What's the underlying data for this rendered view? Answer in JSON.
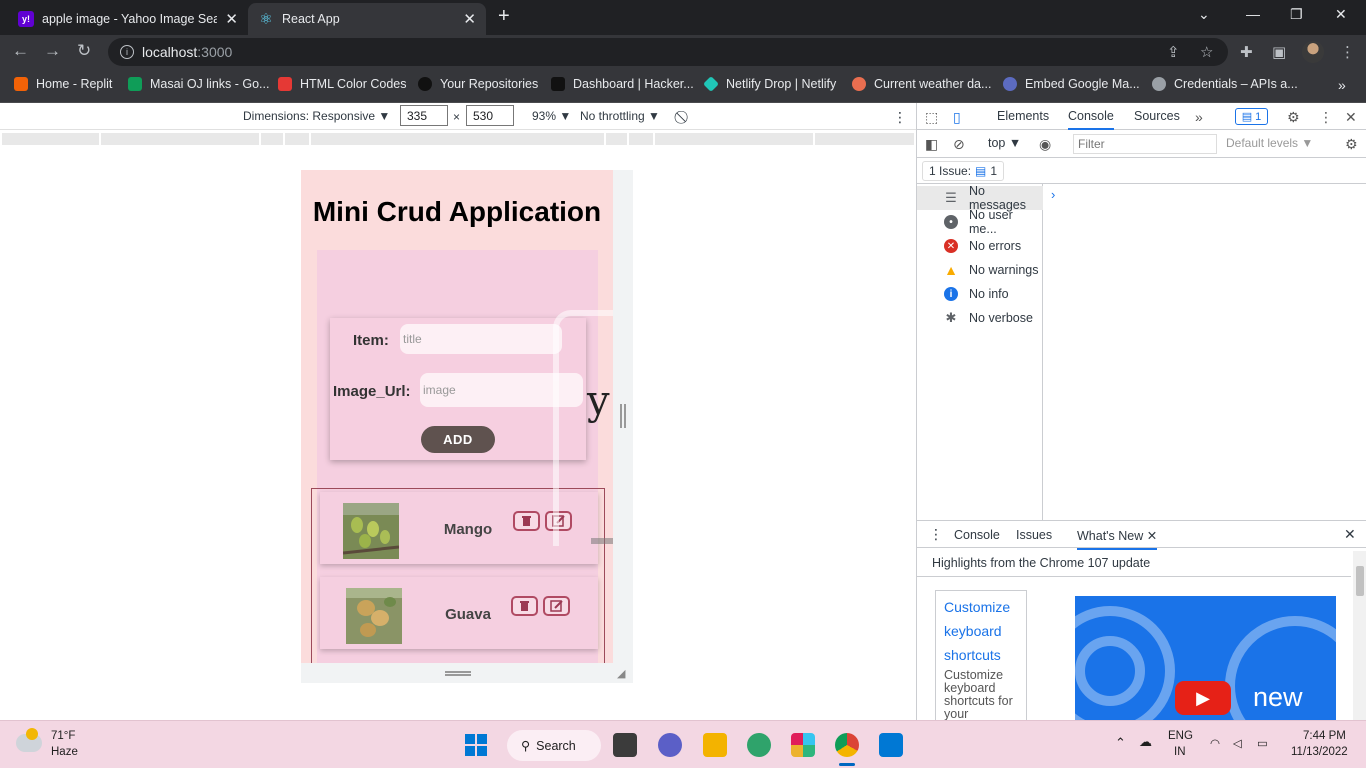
{
  "tabs": [
    {
      "title": "apple image - Yahoo Image Searc",
      "icon": "yahoo-icon",
      "favicon_text": "y!",
      "color": "#6001d2"
    },
    {
      "title": "React App",
      "icon": "react-icon",
      "color": "#61dafb"
    }
  ],
  "address": {
    "host": "localhost",
    "port": ":3000"
  },
  "bookmarks": [
    {
      "label": "Home - Replit",
      "icon": "replit-icon",
      "color": "#f26207"
    },
    {
      "label": "Masai OJ links - Go...",
      "icon": "sheets-icon",
      "color": "#0f9d58"
    },
    {
      "label": "HTML Color Codes",
      "icon": "color-codes-icon",
      "color": "#e53935"
    },
    {
      "label": "Your Repositories",
      "icon": "github-icon",
      "color": "#24292e"
    },
    {
      "label": "Dashboard | Hacker...",
      "icon": "hackerrank-icon",
      "color": "#111111"
    },
    {
      "label": "Netlify Drop | Netlify",
      "icon": "netlify-icon",
      "color": "#20c6b7"
    },
    {
      "label": "Current weather da...",
      "icon": "weather-icon",
      "color": "#e96e50"
    },
    {
      "label": "Embed Google Ma...",
      "icon": "google-maps-icon",
      "color": "#5c6bc0"
    },
    {
      "label": "Credentials – APIs a...",
      "icon": "cloud-icon",
      "color": "#9aa0a6"
    }
  ],
  "device_toolbar": {
    "dimensions": "Dimensions: Responsive ▼",
    "width": "335",
    "times": "×",
    "height": "530",
    "zoom": "93% ▼",
    "throttle": "No throttling ▼"
  },
  "app": {
    "title": "Mini Crud Application",
    "item_label": "Item:",
    "item_placeholder": "title",
    "image_label": "Image_Url:",
    "image_placeholder": "image",
    "add_button": "ADD",
    "overlay_text": "y",
    "items": [
      {
        "name": "Mango",
        "thumb_color": "#7a8a55"
      },
      {
        "name": "Guava",
        "thumb_color": "#8a9466"
      }
    ]
  },
  "devtools": {
    "tabs": [
      "Elements",
      "Console",
      "Sources"
    ],
    "active_tab": "Console",
    "issues_badge": "1",
    "context": "top ▼",
    "filter_placeholder": "Filter",
    "levels": "Default levels ▼",
    "issue_count": "1 Issue:",
    "issue_num": "1",
    "sidebar": [
      {
        "label": "No messages",
        "icon": "list-icon",
        "color": "#5f6368"
      },
      {
        "label": "No user me...",
        "icon": "user-icon",
        "color": "#5f6368"
      },
      {
        "label": "No errors",
        "icon": "error-icon",
        "color": "#d93025"
      },
      {
        "label": "No warnings",
        "icon": "warning-icon",
        "color": "#f9ab00"
      },
      {
        "label": "No info",
        "icon": "info-icon",
        "color": "#1a73e8"
      },
      {
        "label": "No verbose",
        "icon": "bug-icon",
        "color": "#5f6368"
      }
    ],
    "drawer_tabs": [
      "Console",
      "Issues",
      "What's New"
    ],
    "highlights": "Highlights from the Chrome 107 update",
    "tip_links": [
      "Customize",
      "keyboard",
      "shortcuts"
    ],
    "tip_desc": "Customize keyboard shortcuts for your favourite",
    "promo_new": "new"
  },
  "taskbar": {
    "temp": "71°F",
    "condition": "Haze",
    "search": "Search",
    "lang1": "ENG",
    "lang2": "IN",
    "time": "7:44 PM",
    "date": "11/13/2022"
  }
}
